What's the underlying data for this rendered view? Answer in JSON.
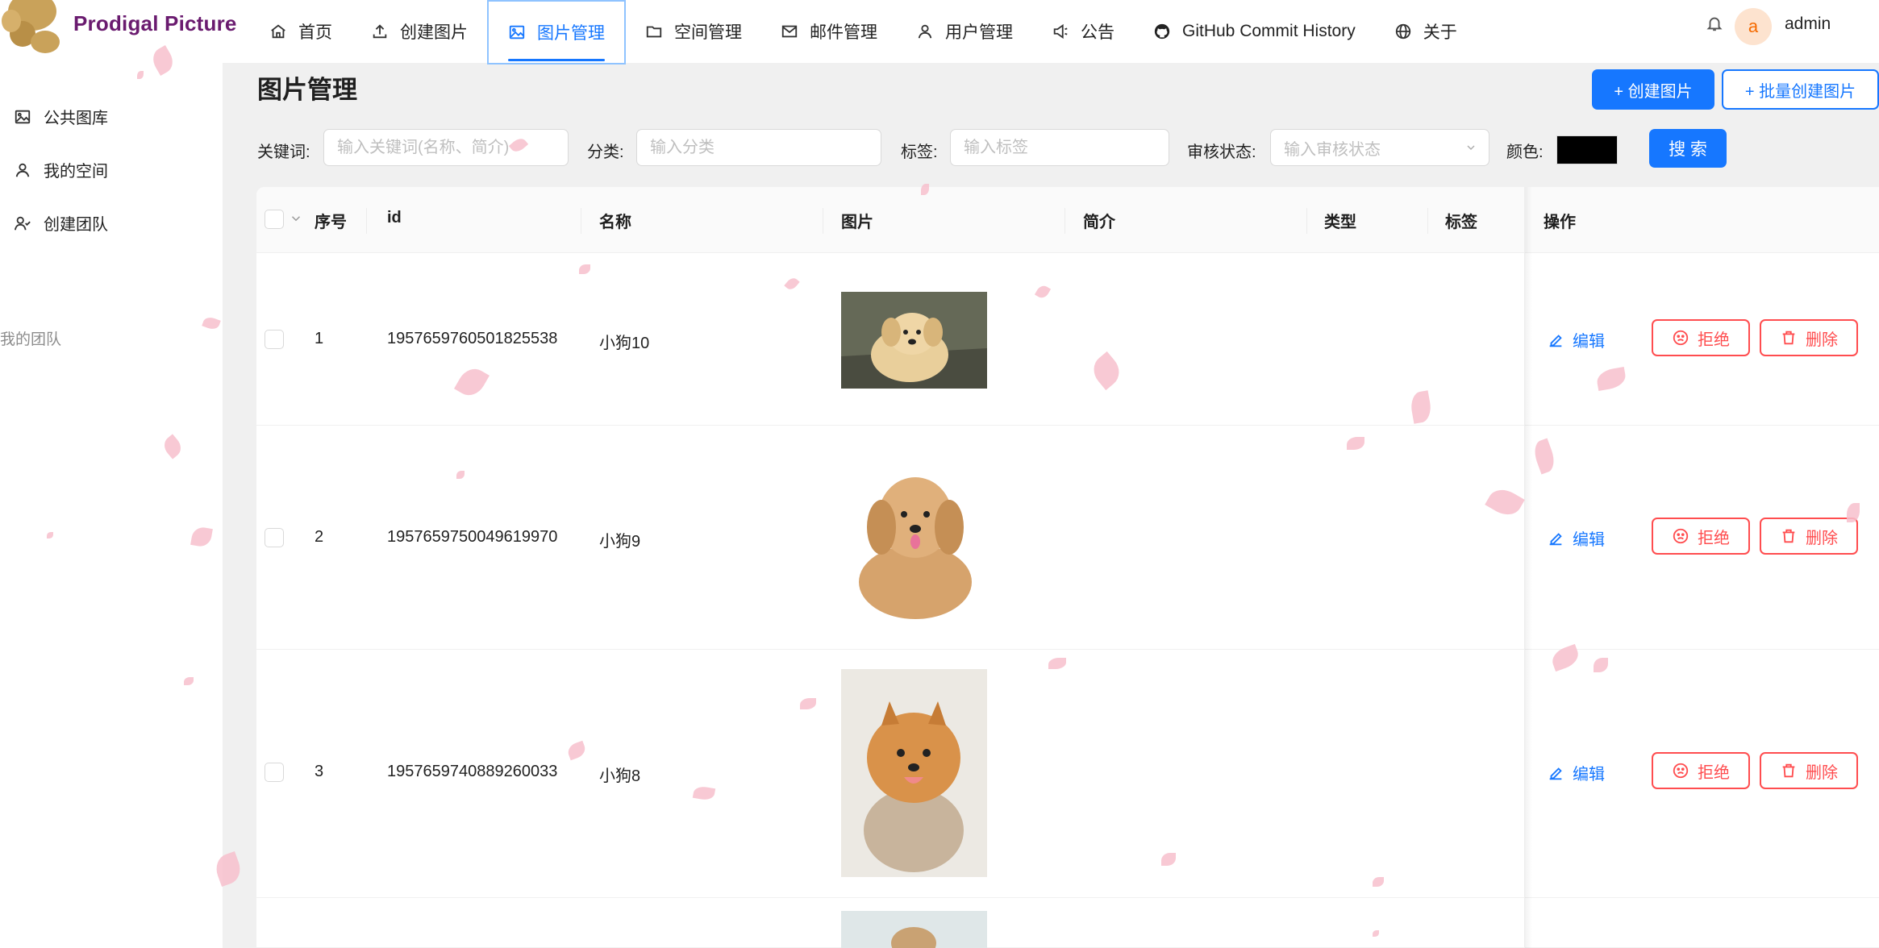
{
  "brand": {
    "name": "Prodigal Picture"
  },
  "nav": {
    "items": [
      {
        "label": "首页",
        "icon": "home-icon"
      },
      {
        "label": "创建图片",
        "icon": "upload-icon"
      },
      {
        "label": "图片管理",
        "icon": "picture-icon",
        "active": true
      },
      {
        "label": "空间管理",
        "icon": "folder-icon"
      },
      {
        "label": "邮件管理",
        "icon": "mail-icon"
      },
      {
        "label": "用户管理",
        "icon": "user-icon"
      },
      {
        "label": "公告",
        "icon": "sound-icon"
      },
      {
        "label": "GitHub Commit History",
        "icon": "github-icon"
      },
      {
        "label": "关于",
        "icon": "globe-icon"
      }
    ]
  },
  "user": {
    "avatar_letter": "a",
    "name": "admin"
  },
  "sidebar": {
    "items": [
      {
        "label": "公共图库",
        "icon": "picture-icon"
      },
      {
        "label": "我的空间",
        "icon": "user-icon"
      },
      {
        "label": "创建团队",
        "icon": "team-icon"
      }
    ],
    "group_label": "我的团队"
  },
  "main": {
    "title": "图片管理",
    "create_button": "+ 创建图片",
    "batch_create_button": "+ 批量创建图片",
    "search_button": "搜 索"
  },
  "filters": {
    "keyword_label": "关键词:",
    "keyword_placeholder": "输入关键词(名称、简介)",
    "category_label": "分类:",
    "category_placeholder": "输入分类",
    "tag_label": "标签:",
    "tag_placeholder": "输入标签",
    "review_label": "审核状态:",
    "review_placeholder": "输入审核状态",
    "color_label": "颜色:",
    "color_value": "#000000"
  },
  "table": {
    "columns": [
      "序号",
      "id",
      "名称",
      "图片",
      "简介",
      "类型",
      "标签",
      "操作"
    ],
    "rows": [
      {
        "index": "1",
        "id": "1957659760501825538",
        "name": "小狗10",
        "intro": "",
        "type": "",
        "tags": ""
      },
      {
        "index": "2",
        "id": "1957659750049619970",
        "name": "小狗9",
        "intro": "",
        "type": "",
        "tags": ""
      },
      {
        "index": "3",
        "id": "1957659740889260033",
        "name": "小狗8",
        "intro": "",
        "type": "",
        "tags": ""
      }
    ],
    "actions": {
      "edit": "编辑",
      "reject": "拒绝",
      "delete": "删除"
    }
  },
  "colors": {
    "accent": "#1677ff",
    "danger": "#ff4d4f",
    "brand": "#6a1b6f",
    "petal": "#f7bfcd"
  }
}
